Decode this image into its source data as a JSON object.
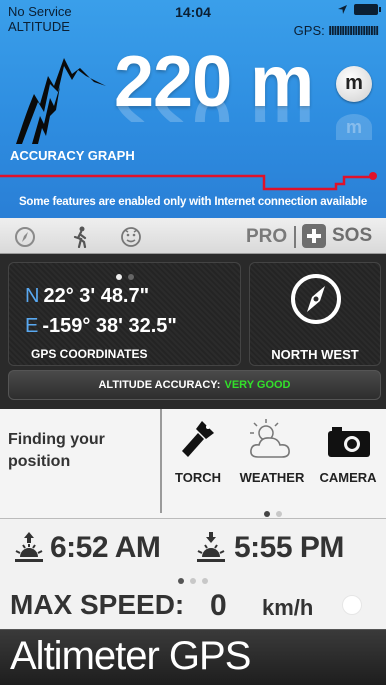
{
  "status_bar": {
    "carrier": "No Service",
    "mode_label": "ALTITUDE",
    "time": "14:04",
    "gps_label": "GPS:",
    "gps_signal_bars": "IIIIIIIIIIIIIIIIIII",
    "location_icon": "location-arrow-icon",
    "battery_icon": "battery-icon"
  },
  "altitude": {
    "value": "220 m",
    "unit_toggle": "m",
    "graph_label": "ACCURACY GRAPH",
    "notice": "Some features are enabled only with Internet connection available"
  },
  "toolbar": {
    "icons": [
      "compass-outline-icon",
      "walker-icon",
      "face-icon"
    ],
    "pro_label": "PRO",
    "sos_label": "SOS"
  },
  "coordinates": {
    "lat_dir": "N",
    "lat": "22° 3' 48.7\"",
    "lon_dir": "E",
    "lon": "-159° 38' 32.5\"",
    "caption": "GPS COORDINATES",
    "heading": "NORTH WEST",
    "accuracy_label": "ALTITUDE ACCURACY:",
    "accuracy_value": "VERY GOOD"
  },
  "utilities": {
    "status": "Finding your position",
    "items": [
      {
        "label": "TORCH",
        "icon": "torch-icon"
      },
      {
        "label": "WEATHER",
        "icon": "cloud-sun-icon"
      },
      {
        "label": "CAMERA",
        "icon": "camera-icon"
      }
    ]
  },
  "sun": {
    "sunrise": "6:52 AM",
    "sunset": "5:55 PM"
  },
  "speed": {
    "label": "MAX SPEED:",
    "value": "0",
    "unit": "km/h"
  },
  "branding": {
    "app_name": "Altimeter GPS"
  },
  "colors": {
    "sky_blue": "#2e8de0",
    "graph_red": "#e0112a",
    "accuracy_good": "#32e02a",
    "coord_dir": "#59a8f0"
  }
}
